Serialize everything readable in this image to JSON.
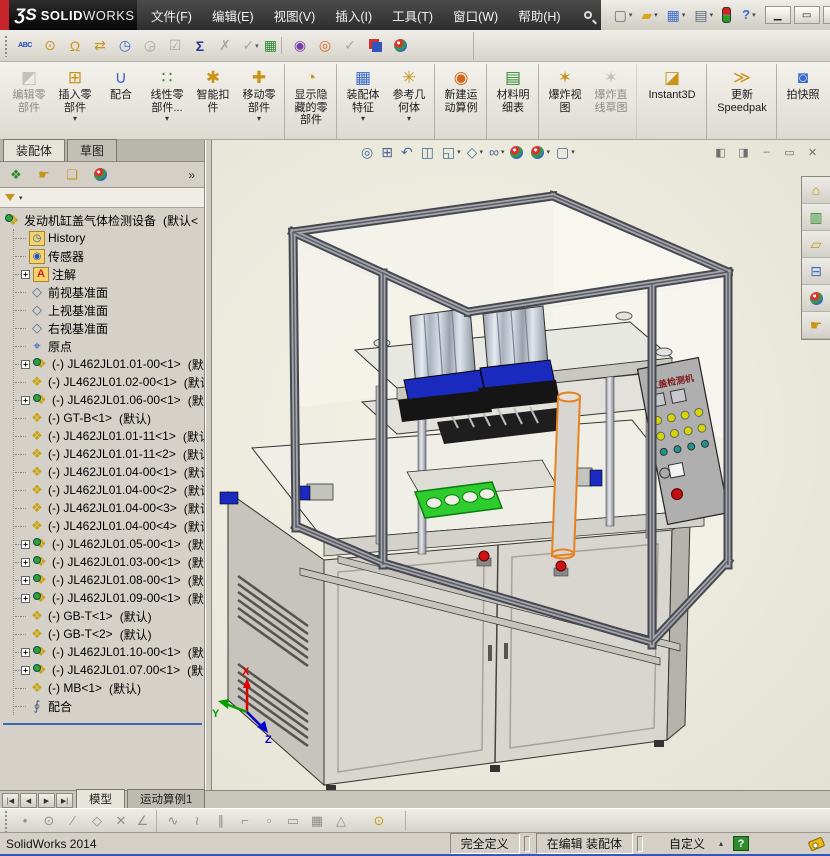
{
  "window": {
    "logo_mark": "ƷS",
    "logo_brand_bold": "SOLID",
    "logo_brand_light": "WORKS",
    "menus": [
      {
        "label": "文件(F)"
      },
      {
        "label": "编辑(E)"
      },
      {
        "label": "视图(V)"
      },
      {
        "label": "插入(I)"
      },
      {
        "label": "工具(T)"
      },
      {
        "label": "窗口(W)"
      },
      {
        "label": "帮助(H)"
      }
    ],
    "quick_icons": [
      {
        "nm": "new-document-icon",
        "glyph": "▢",
        "cls": "q-gray",
        "dd": "▾"
      },
      {
        "nm": "open-icon",
        "glyph": "▰",
        "cls": "q-gold",
        "dd": "▾"
      },
      {
        "nm": "save-icon",
        "glyph": "▦",
        "cls": "q-blue",
        "dd": "▾"
      },
      {
        "nm": "print-icon",
        "glyph": "▤",
        "cls": "q-gray",
        "dd": "▾"
      },
      {
        "nm": "options-traffic-icon",
        "glyph": "",
        "cls": "tl",
        "dd": ""
      },
      {
        "nm": "help-icon",
        "glyph": "?",
        "cls": "q-help",
        "dd": "▾"
      }
    ],
    "win_buttons": [
      {
        "nm": "minimize-button",
        "glyph": "▁"
      },
      {
        "nm": "restore-button",
        "glyph": "▭"
      },
      {
        "nm": "close-button",
        "glyph": "✕"
      }
    ]
  },
  "toolbar2": {
    "icons": [
      {
        "nm": "spell-check-icon",
        "glyph": "ABC",
        "cls": "t-abc",
        "dd": ""
      },
      {
        "nm": "measure-icon",
        "glyph": "⊙",
        "cls": "gold",
        "dd": ""
      },
      {
        "nm": "mass-properties-icon",
        "glyph": "Ω",
        "cls": "gold",
        "dd": ""
      },
      {
        "nm": "transfer-icon",
        "glyph": "⇄",
        "cls": "gold",
        "dd": ""
      },
      {
        "nm": "performance-icon",
        "glyph": "◷",
        "cls": "blue",
        "dd": ""
      },
      {
        "nm": "schedule-icon",
        "glyph": "◶",
        "cls": "dis",
        "dd": ""
      },
      {
        "nm": "verification-icon",
        "glyph": "☑",
        "cls": "dis",
        "dd": ""
      },
      {
        "nm": "equations-icon",
        "glyph": "Σ",
        "cls": "navy",
        "dd": ""
      },
      {
        "nm": "deviation-icon",
        "glyph": "✗",
        "cls": "dis",
        "dd": ""
      },
      {
        "nm": "check-dropdown-icon",
        "glyph": "✓",
        "cls": "dis",
        "dd": "▾"
      },
      {
        "nm": "design-table-icon",
        "glyph": "▦",
        "cls": "green sepafter",
        "dd": ""
      },
      {
        "nm": "render-preview-icon",
        "glyph": "◉",
        "cls": "purple",
        "dd": ""
      },
      {
        "nm": "render-options-icon",
        "glyph": "◎",
        "cls": "orange",
        "dd": ""
      },
      {
        "nm": "approve-icon",
        "glyph": "✓",
        "cls": "dis",
        "dd": ""
      },
      {
        "nm": "edit-appearance-squares-icon",
        "glyph": "",
        "cls": "sq2",
        "dd": ""
      },
      {
        "nm": "appearance-sphere-icon",
        "glyph": "",
        "cls": "ball",
        "dd": ""
      }
    ]
  },
  "ribbon": {
    "buttons": [
      {
        "label": "编辑零部件",
        "icon": "◩",
        "ic": "ic-gray",
        "cls": "disabled",
        "dd": ""
      },
      {
        "label": "插入零部件",
        "icon": "⊞",
        "ic": "ic-gold",
        "cls": "",
        "dd": "▾"
      },
      {
        "label": "配合",
        "icon": "∪",
        "ic": "ic-steel",
        "cls": "",
        "dd": ""
      },
      {
        "label": "线性零部件...",
        "icon": "∷",
        "ic": "ic-green",
        "cls": "",
        "dd": "▾"
      },
      {
        "label": "智能扣件",
        "icon": "✱",
        "ic": "ic-gold",
        "cls": "",
        "dd": ""
      },
      {
        "label": "移动零部件",
        "icon": "✚",
        "ic": "ic-gold",
        "cls": "sep",
        "dd": "▾"
      },
      {
        "label": "显示隐藏的零部件",
        "icon": "◔",
        "ic": "ic-gold",
        "cls": "sep",
        "dd": ""
      },
      {
        "label": "装配体特征",
        "icon": "▦",
        "ic": "ic-steel",
        "cls": "",
        "dd": "▾"
      },
      {
        "label": "参考几何体",
        "icon": "✳",
        "ic": "ic-gold",
        "cls": "sep",
        "dd": "▾"
      },
      {
        "label": "新建运动算例",
        "icon": "◉",
        "ic": "ic-orange",
        "cls": "sep",
        "dd": ""
      },
      {
        "label": "材料明细表",
        "icon": "▤",
        "ic": "ic-green",
        "cls": "sep",
        "dd": ""
      },
      {
        "label": "爆炸视图",
        "icon": "✶",
        "ic": "ic-gold",
        "cls": "",
        "dd": ""
      },
      {
        "label": "爆炸直线草图",
        "icon": "✶",
        "ic": "ic-gray",
        "cls": "disabled sep",
        "dd": ""
      },
      {
        "label": "Instant3D",
        "icon": "◪",
        "ic": "ic-gold",
        "cls": "wide sep",
        "dd": ""
      },
      {
        "label": "更新\nSpeedpak",
        "icon": "≫",
        "ic": "ic-gold",
        "cls": "wide sep",
        "dd": ""
      },
      {
        "label": "拍快照",
        "icon": "◙",
        "ic": "ic-steel",
        "cls": "",
        "dd": ""
      }
    ]
  },
  "left_panel": {
    "cm_tabs": [
      {
        "label": "装配体",
        "cls": "active"
      },
      {
        "label": "草图",
        "cls": ""
      }
    ],
    "fm_tabs": [
      {
        "nm": "featuremanager-tab-icon",
        "glyph": "❖",
        "cls": "fmA active"
      },
      {
        "nm": "propertymanager-tab-icon",
        "glyph": "☛",
        "cls": "fmB"
      },
      {
        "nm": "configurationmanager-tab-icon",
        "glyph": "❏",
        "cls": "fmC"
      },
      {
        "nm": "displaymanager-tab-icon",
        "glyph": "",
        "cls": "ball"
      }
    ],
    "fm_chevron": "»",
    "filter_dd": "▾"
  },
  "tree": {
    "root": {
      "label": "发动机缸盖气体检测设备",
      "suffix": "(默认<"
    },
    "items": [
      {
        "label": "History",
        "sfx": "",
        "icls": "it-hist",
        "exp": "",
        "expcls": "nop"
      },
      {
        "label": "传感器",
        "sfx": "",
        "icls": "it-sensor",
        "exp": "",
        "expcls": "nop"
      },
      {
        "label": "注解",
        "sfx": "",
        "icls": "it-ann",
        "exp": "+",
        "expcls": "plus"
      },
      {
        "label": "前视基准面",
        "sfx": "",
        "icls": "it-plane",
        "exp": "",
        "expcls": "nop"
      },
      {
        "label": "上视基准面",
        "sfx": "",
        "icls": "it-plane",
        "exp": "",
        "expcls": "nop"
      },
      {
        "label": "右视基准面",
        "sfx": "",
        "icls": "it-plane",
        "exp": "",
        "expcls": "nop"
      },
      {
        "label": "原点",
        "sfx": "",
        "icls": "it-origin",
        "exp": "",
        "expcls": "nop"
      },
      {
        "label": "(-) JL462JL01.01-00<1>",
        "sfx": "(默认",
        "icls": "it-asm",
        "exp": "+",
        "expcls": "plus"
      },
      {
        "label": "(-) JL462JL01.02-00<1>",
        "sfx": "(默认",
        "icls": "it-part",
        "exp": "",
        "expcls": "nop"
      },
      {
        "label": "(-) JL462JL01.06-00<1>",
        "sfx": "(默认",
        "icls": "it-asm",
        "exp": "+",
        "expcls": "plus"
      },
      {
        "label": "(-) GT-B<1>",
        "sfx": "(默认)",
        "icls": "it-part",
        "exp": "",
        "expcls": "nop"
      },
      {
        "label": "(-) JL462JL01.01-11<1>",
        "sfx": "(默认",
        "icls": "it-part",
        "exp": "",
        "expcls": "nop"
      },
      {
        "label": "(-) JL462JL01.01-11<2>",
        "sfx": "(默认",
        "icls": "it-part",
        "exp": "",
        "expcls": "nop"
      },
      {
        "label": "(-) JL462JL01.04-00<1>",
        "sfx": "(默认",
        "icls": "it-part",
        "exp": "",
        "expcls": "nop"
      },
      {
        "label": "(-) JL462JL01.04-00<2>",
        "sfx": "(默认",
        "icls": "it-part",
        "exp": "",
        "expcls": "nop"
      },
      {
        "label": "(-) JL462JL01.04-00<3>",
        "sfx": "(默认",
        "icls": "it-part",
        "exp": "",
        "expcls": "nop"
      },
      {
        "label": "(-) JL462JL01.04-00<4>",
        "sfx": "(默认",
        "icls": "it-part",
        "exp": "",
        "expcls": "nop"
      },
      {
        "label": "(-) JL462JL01.05-00<1>",
        "sfx": "(默认",
        "icls": "it-asm",
        "exp": "+",
        "expcls": "plus"
      },
      {
        "label": "(-) JL462JL01.03-00<1>",
        "sfx": "(默认",
        "icls": "it-asm",
        "exp": "+",
        "expcls": "plus"
      },
      {
        "label": "(-) JL462JL01.08-00<1>",
        "sfx": "(默认",
        "icls": "it-asm",
        "exp": "+",
        "expcls": "plus"
      },
      {
        "label": "(-) JL462JL01.09-00<1>",
        "sfx": "(默认",
        "icls": "it-asm",
        "exp": "+",
        "expcls": "plus"
      },
      {
        "label": "(-) GB-T<1>",
        "sfx": "(默认)",
        "icls": "it-part",
        "exp": "",
        "expcls": "nop"
      },
      {
        "label": "(-) GB-T<2>",
        "sfx": "(默认)",
        "icls": "it-part",
        "exp": "",
        "expcls": "nop"
      },
      {
        "label": "(-) JL462JL01.10-00<1>",
        "sfx": "(默认",
        "icls": "it-asm",
        "exp": "+",
        "expcls": "plus"
      },
      {
        "label": "(-) JL462JL01.07.00<1>",
        "sfx": "(默认",
        "icls": "it-asm",
        "exp": "+",
        "expcls": "plus"
      },
      {
        "label": "(-) MB<1>",
        "sfx": "(默认)",
        "icls": "it-part",
        "exp": "",
        "expcls": "nop"
      },
      {
        "label": "配合",
        "sfx": "",
        "icls": "it-mate",
        "exp": "",
        "expcls": "nop"
      }
    ]
  },
  "viewport": {
    "headsup": [
      {
        "nm": "zoom-fit-icon",
        "glyph": "◎",
        "cls": "",
        "dd": ""
      },
      {
        "nm": "zoom-area-icon",
        "glyph": "⊞",
        "cls": "",
        "dd": ""
      },
      {
        "nm": "previous-view-icon",
        "glyph": "↶",
        "cls": "",
        "dd": ""
      },
      {
        "nm": "section-view-icon",
        "glyph": "◫",
        "cls": "",
        "dd": ""
      },
      {
        "nm": "view-orientation-icon",
        "glyph": "◱",
        "cls": "",
        "dd": "▾"
      },
      {
        "nm": "display-style-icon",
        "glyph": "◇",
        "cls": "",
        "dd": "▾"
      },
      {
        "nm": "hide-show-items-icon",
        "glyph": "∞",
        "cls": "",
        "dd": "▾"
      },
      {
        "nm": "edit-appearance-icon",
        "glyph": "",
        "cls": "ball",
        "dd": ""
      },
      {
        "nm": "apply-scene-icon",
        "glyph": "",
        "cls": "ball",
        "dd": "▾"
      },
      {
        "nm": "view-settings-icon",
        "glyph": "▢",
        "cls": "",
        "dd": "▾"
      }
    ],
    "doc_controls": [
      {
        "nm": "pane-left-icon",
        "glyph": "◧"
      },
      {
        "nm": "pane-right-icon",
        "glyph": "◨"
      },
      {
        "nm": "doc-minimize-icon",
        "glyph": "–"
      },
      {
        "nm": "doc-restore-icon",
        "glyph": "▭"
      },
      {
        "nm": "doc-close-icon",
        "glyph": "✕"
      }
    ],
    "taskpane": [
      {
        "nm": "solidworks-resources-icon",
        "glyph": "⌂",
        "cls": "tp-gold"
      },
      {
        "nm": "design-library-icon",
        "glyph": "▥",
        "cls": "tp-multi"
      },
      {
        "nm": "file-explorer-icon",
        "glyph": "▱",
        "cls": "tp-gold"
      },
      {
        "nm": "view-palette-icon",
        "glyph": "⊟",
        "cls": "tp-blue"
      },
      {
        "nm": "appearances-scenes-icon",
        "glyph": "",
        "cls": "ball"
      },
      {
        "nm": "custom-properties-icon",
        "glyph": "☛",
        "cls": "tp-gold"
      }
    ],
    "machine": {
      "panel_title": "缸盖检测机",
      "triad": {
        "x": "X",
        "y": "Y",
        "z": "Z"
      }
    }
  },
  "bottom": {
    "nav": [
      {
        "nm": "first-tab-button",
        "glyph": "|◀"
      },
      {
        "nm": "prev-tab-button",
        "glyph": "◀"
      },
      {
        "nm": "next-tab-button",
        "glyph": "▶"
      },
      {
        "nm": "last-tab-button",
        "glyph": "▶|"
      }
    ],
    "tabs": [
      {
        "label": "模型",
        "cls": "active"
      },
      {
        "label": "运动算例1",
        "cls": ""
      }
    ],
    "sketch_icons": [
      {
        "nm": "point-icon",
        "glyph": "•",
        "cls": ""
      },
      {
        "nm": "circle-icon",
        "glyph": "⊙",
        "cls": ""
      },
      {
        "nm": "line-icon",
        "glyph": "∕",
        "cls": ""
      },
      {
        "nm": "polygon-icon",
        "glyph": "◇",
        "cls": ""
      },
      {
        "nm": "trim-icon",
        "glyph": "✕",
        "cls": ""
      },
      {
        "nm": "angle-icon",
        "glyph": "∠",
        "cls": "sepafter"
      },
      {
        "nm": "spline-icon",
        "glyph": "∿",
        "cls": ""
      },
      {
        "nm": "arc-icon",
        "glyph": "≀",
        "cls": ""
      },
      {
        "nm": "parallel-icon",
        "glyph": "∥",
        "cls": ""
      },
      {
        "nm": "corner-icon",
        "glyph": "⌐",
        "cls": ""
      },
      {
        "nm": "pattern-icon",
        "glyph": "▫",
        "cls": ""
      },
      {
        "nm": "slot-icon",
        "glyph": "▭",
        "cls": ""
      },
      {
        "nm": "grid-icon",
        "glyph": "▦",
        "cls": ""
      },
      {
        "nm": "triangle-icon",
        "glyph": "△",
        "cls": ""
      },
      {
        "nm": "measure-icon",
        "glyph": "⊙",
        "cls": "gold"
      }
    ]
  },
  "statusbar": {
    "app_version": "SolidWorks 2014",
    "fully_defined": "完全定义",
    "edit_mode": "在编辑 装配体",
    "custom": "自定义",
    "custom_arrow": "▴",
    "help_glyph": "?"
  },
  "colors": {
    "logo_red": "#C8242B",
    "selection_orange": "#E8821E",
    "gasket_green": "#2ECC2E",
    "cylinder_base_blue": "#1A2ABF"
  }
}
